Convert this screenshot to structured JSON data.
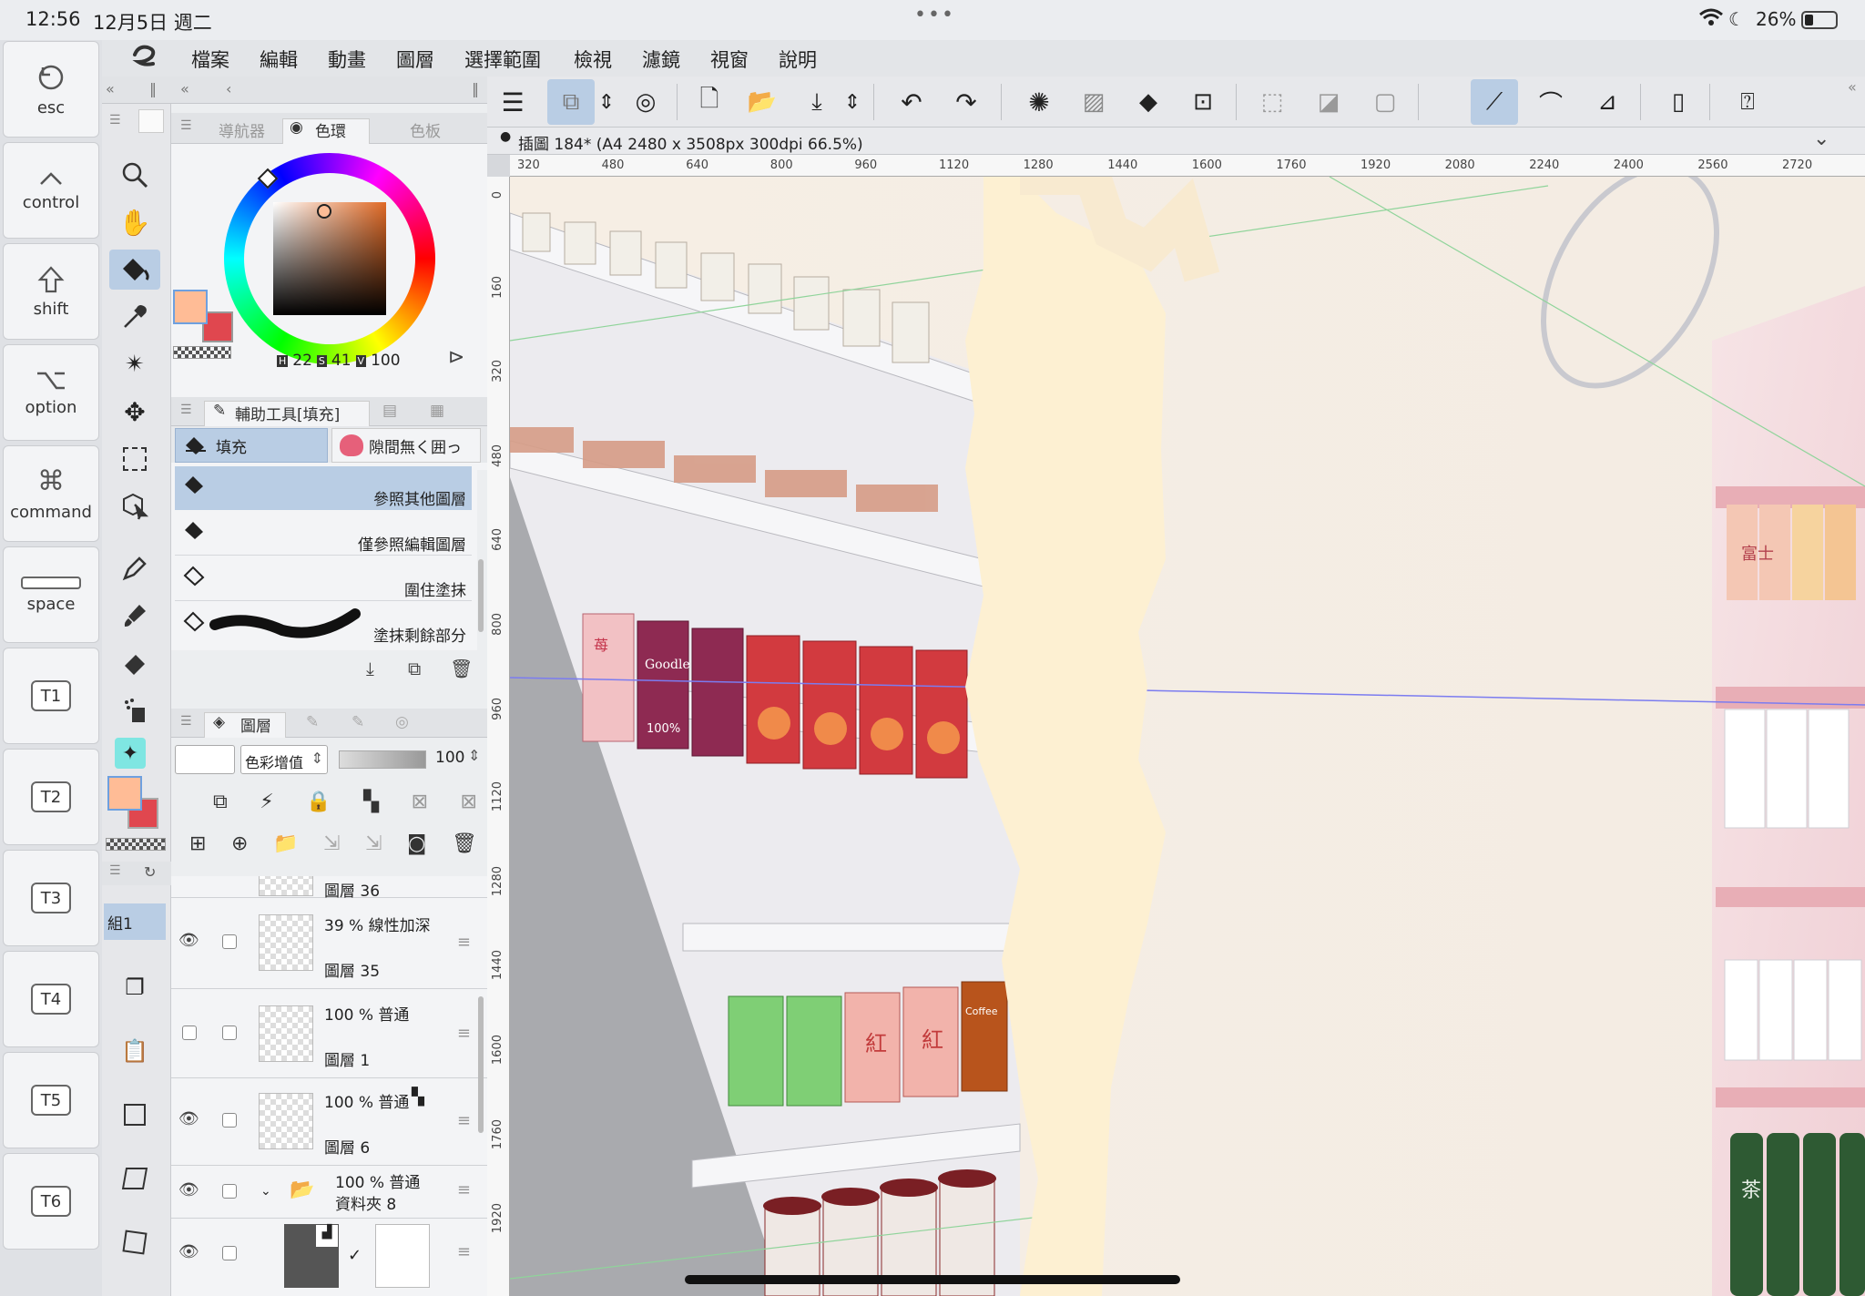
{
  "status_bar": {
    "time": "12:56",
    "date": "12月5日 週二",
    "battery": "26%"
  },
  "edge_keys": [
    {
      "label": "esc",
      "icon": "esc-icon"
    },
    {
      "label": "control",
      "icon": "control-icon"
    },
    {
      "label": "shift",
      "icon": "shift-icon"
    },
    {
      "label": "option",
      "icon": "option-icon"
    },
    {
      "label": "command",
      "icon": "command-icon"
    },
    {
      "label": "space",
      "icon": "space-icon"
    },
    {
      "label": "T1"
    },
    {
      "label": "T2"
    },
    {
      "label": "T3"
    },
    {
      "label": "T4"
    },
    {
      "label": "T5"
    },
    {
      "label": "T6"
    }
  ],
  "menu": [
    "檔案",
    "編輯",
    "動畫",
    "圖層",
    "選擇範圍",
    "檢視",
    "濾鏡",
    "視窗",
    "說明"
  ],
  "panels": {
    "color_tabs": [
      "導航器",
      "色環",
      "色板"
    ],
    "hsv": {
      "h_label": "H",
      "h": "22",
      "s_label": "S",
      "s": "41",
      "v_label": "V",
      "v": "100"
    },
    "colors": {
      "main": "#FFBC96",
      "sub": "#E0474F"
    },
    "subtool_title": "輔助工具[填充]",
    "subtool_tabs": [
      "填充",
      "隙間無く囲っ"
    ],
    "fill_items": [
      "參照其他圖層",
      "僅參照編輯圖層",
      "圍住塗抹",
      "塗抹剩餘部分"
    ],
    "layer_tab": "圖層",
    "blend_mode": "色彩增值",
    "opacity": "100",
    "group_label": "組1",
    "layers": [
      {
        "name": "圖層 36"
      },
      {
        "mode": "39 % 線性加深",
        "name": "圖層 35"
      },
      {
        "mode": "100 % 普通",
        "name": "圖層 1"
      },
      {
        "mode": "100 % 普通",
        "name": "圖層 6"
      },
      {
        "mode": "100 % 普通",
        "name": "資料夾 8"
      }
    ]
  },
  "canvas": {
    "doc_title": "插圖 184* (A4 2480 x 3508px 300dpi 66.5%)",
    "ruler_h": [
      "320",
      "480",
      "640",
      "800",
      "960",
      "1120",
      "1280",
      "1440",
      "1600",
      "1760",
      "1920",
      "2080",
      "2240",
      "2400",
      "2560",
      "2720"
    ],
    "ruler_v": [
      "0",
      "160",
      "320",
      "480",
      "640",
      "800",
      "960",
      "1120",
      "1280",
      "1440",
      "1600",
      "1760",
      "1920"
    ],
    "packaging": {
      "strawberry": "苺",
      "grape": "Goodle",
      "percent": "100%",
      "red": "紅",
      "coffee": "Coffee",
      "tea": "茶",
      "peach": "富士"
    }
  }
}
